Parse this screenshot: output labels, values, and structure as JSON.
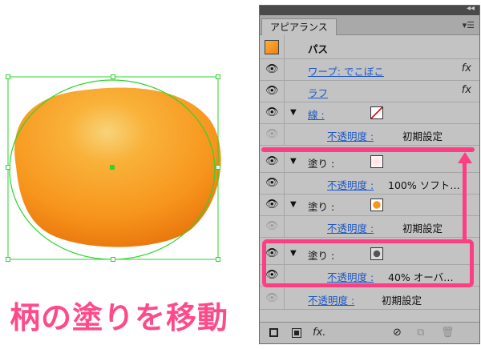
{
  "caption": "柄の塗りを移動",
  "panel": {
    "tab_label": "アピアランス",
    "collapse_glyph": "◂◂",
    "menu_glyph": "▾☰",
    "object_label": "パス",
    "rows": {
      "warp": "ワープ: でこぼこ",
      "roughen": "ラフ",
      "stroke": "線 :",
      "stroke_opacity_label": "不透明度 :",
      "stroke_opacity_value": "初期設定",
      "fill1": "塗り :",
      "fill1_opacity_label": "不透明度 :",
      "fill1_opacity_value": "100% ソフト…",
      "fill2": "塗り :",
      "fill2_opacity_label": "不透明度 :",
      "fill2_opacity_value": "初期設定",
      "fill3": "塗り :",
      "fill3_opacity_label": "不透明度 :",
      "fill3_opacity_value": "40% オーバ…",
      "obj_opacity_label": "不透明度 :",
      "obj_opacity_value": "初期設定"
    },
    "fx_glyph": "fx",
    "bottom_fx": "fx.",
    "eye_glyph": "👁",
    "tri_glyph": "▼"
  },
  "colors": {
    "accent_pink": "#ff3d84",
    "orange": "#f7951d",
    "selection_green": "#2ad62a"
  }
}
